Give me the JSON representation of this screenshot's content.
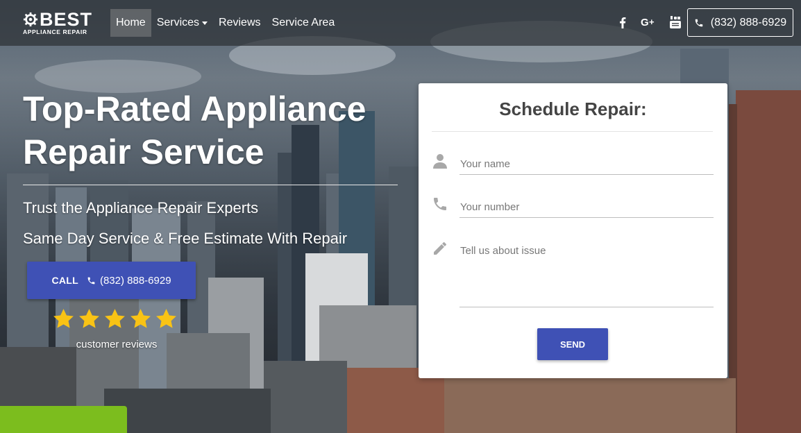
{
  "nav": {
    "logo_word": "BEST",
    "logo_sub": "APPLIANCE REPAIR",
    "links": [
      "Home",
      "Services",
      "Reviews",
      "Service Area"
    ],
    "phone": "(832) 888-6929",
    "social_icons": [
      "facebook-icon",
      "google-plus-icon",
      "youtube-icon"
    ]
  },
  "hero": {
    "title": "Top-Rated Appliance Repair Service",
    "subtitle1": "Trust the Appliance Repair Experts",
    "subtitle2": "Same Day Service & Free Estimate With Repair",
    "call_label": "CALL",
    "call_phone": "(832) 888-6929",
    "rating_stars": 5,
    "reviews_label": "customer reviews"
  },
  "form": {
    "title": "Schedule Repair:",
    "name_placeholder": "Your name",
    "number_placeholder": "Your number",
    "issue_placeholder": "Tell us about issue",
    "send_label": "SEND"
  },
  "colors": {
    "primary": "#3f51b5",
    "accent_green": "#7cbd1e",
    "star": "#f9c315"
  }
}
